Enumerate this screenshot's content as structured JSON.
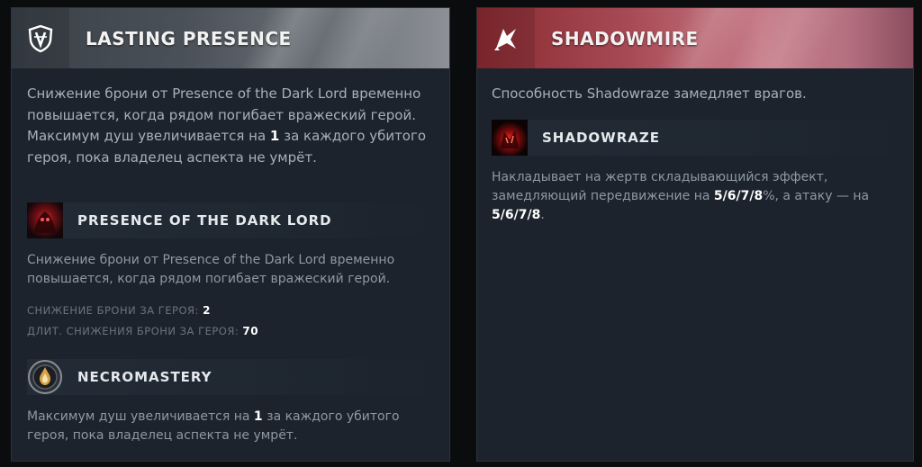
{
  "left": {
    "title": "LASTING PRESENCE",
    "header_icon": "shield-aspect-icon",
    "desc_part1": "Снижение брони от Presence of the Dark Lord временно повышается, когда рядом погибает вражеский герой. Максимум душ увеличивается на ",
    "desc_value": "1",
    "desc_part2": " за каждого убитого героя, пока владелец аспекта не умрёт.",
    "ability1": {
      "name": "PRESENCE OF THE DARK LORD",
      "icon": "dark-lord-icon",
      "desc": "Снижение брони от Presence of the Dark Lord временно повышается, когда рядом погибает вражеский герой.",
      "stat1_label": "СНИЖЕНИЕ БРОНИ ЗА ГЕРОЯ:",
      "stat1_value": "2",
      "stat2_label": "ДЛИТ. СНИЖЕНИЯ БРОНИ ЗА ГЕРОЯ:",
      "stat2_value": "70"
    },
    "ability2": {
      "name": "NECROMASTERY",
      "icon": "necromastery-icon",
      "desc_part1": "Максимум душ увеличивается на ",
      "desc_value": "1",
      "desc_part2": " за каждого убитого героя, пока владелец аспекта не умрёт."
    }
  },
  "right": {
    "title": "SHADOWMIRE",
    "header_icon": "shadowmire-aspect-icon",
    "desc": "Способность Shadowraze замедляет врагов.",
    "ability1": {
      "name": "SHADOWRAZE",
      "icon": "shadowraze-icon",
      "desc_part1": "Накладывает на жертв складывающийся эффект, замедляющий передвижение на ",
      "desc_value1": "5/6/7/8",
      "desc_part2": "%, а атаку — на ",
      "desc_value2": "5/6/7/8",
      "desc_part3": "."
    }
  },
  "colors": {
    "panel_bg": "#1c232c",
    "left_header": "#6e737a",
    "right_header": "#c67b88",
    "text": "#a7b0ba",
    "highlight": "#ffffff"
  }
}
